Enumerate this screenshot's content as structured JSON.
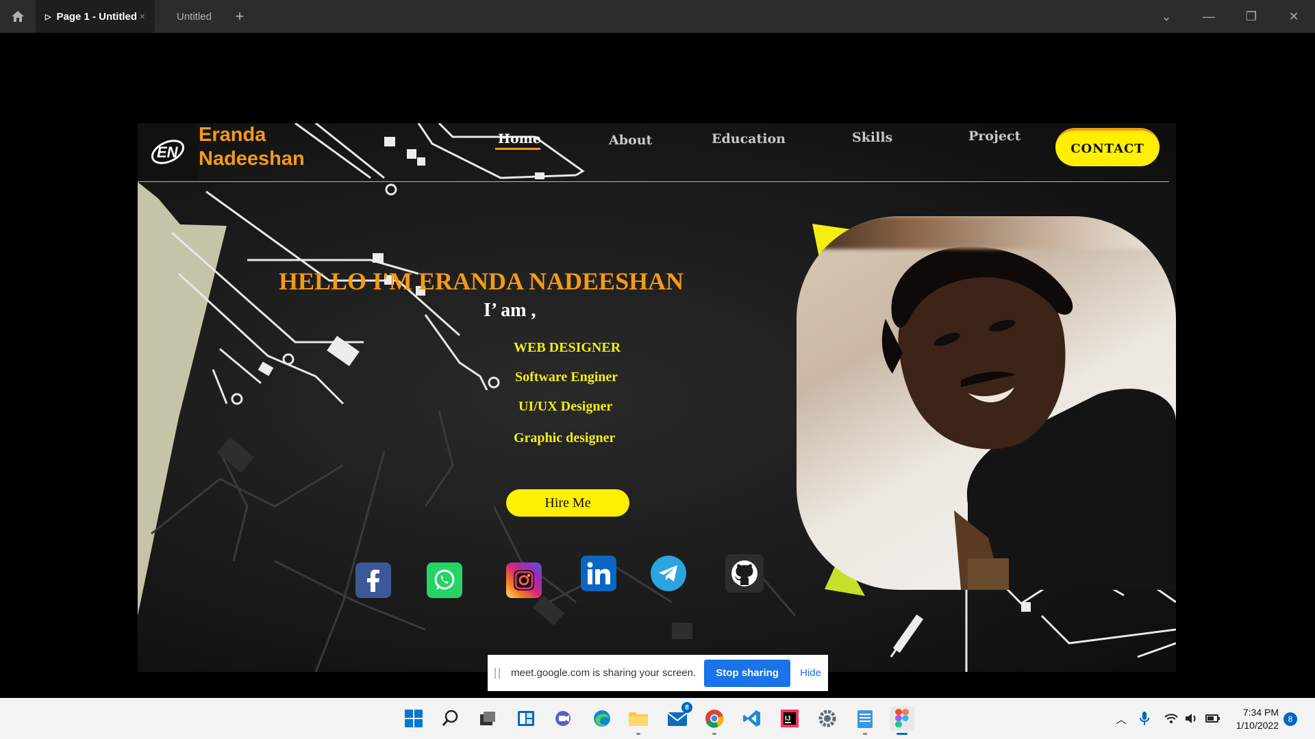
{
  "figma": {
    "active_tab": "Page 1 - Untitled",
    "second_tab": "Untitled",
    "new_tab_symbol": "+"
  },
  "site": {
    "brand_first": "Eranda",
    "brand_last": "Nadeeshan",
    "nav": [
      "Home",
      "About",
      "Education",
      "Skills",
      "Project"
    ],
    "contact_label": "CONTACT",
    "hello": "HELLO I'M ERANDA  NADEESHAN",
    "iam": "I’ am ,",
    "roles": [
      "WEB  DESIGNER",
      "Software Enginer",
      "UI/UX  Designer",
      "Graphic designer"
    ],
    "hire_label": "Hire Me",
    "socials": [
      "facebook-icon",
      "whatsapp-icon",
      "instagram-icon",
      "linkedin-icon",
      "telegram-icon",
      "github-icon"
    ],
    "accent_color": "#f59a14",
    "highlight_color": "#ffef00"
  },
  "share_bar": {
    "message": "meet.google.com is sharing your screen.",
    "stop_label": "Stop sharing",
    "hide_label": "Hide"
  },
  "taskbar": {
    "mail_badge": "8",
    "time": "7:34 PM",
    "date": "1/10/2022",
    "notification_count": "8"
  }
}
